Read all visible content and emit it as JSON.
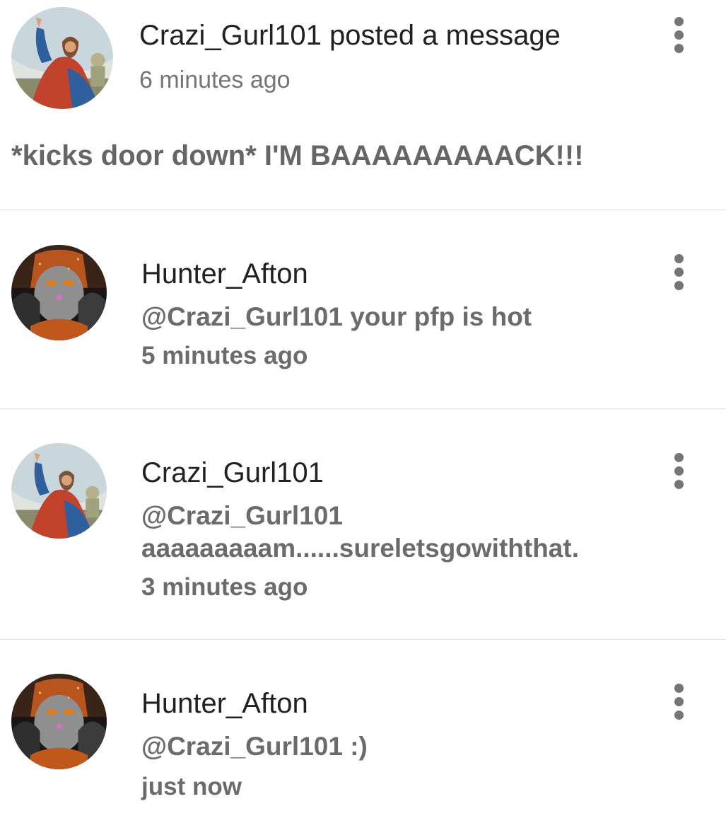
{
  "post": {
    "author": "Crazi_Gurl101",
    "title": "Crazi_Gurl101 posted a message",
    "time": "6 minutes ago",
    "body": "*kicks door down* I'M BAAAAAAAAACK!!!",
    "avatar": "jesus-painting-avatar"
  },
  "comments": [
    {
      "author": "Hunter_Afton",
      "text_line1": "@Crazi_Gurl101 your pfp is hot",
      "text_line2": "",
      "time": "5 minutes ago",
      "avatar": "dark-character-avatar"
    },
    {
      "author": "Crazi_Gurl101",
      "text_line1": "@Crazi_Gurl101",
      "text_line2": "aaaaaaaaam......sureletsgowiththat.",
      "time": "3 minutes ago",
      "avatar": "jesus-painting-avatar"
    },
    {
      "author": "Hunter_Afton",
      "text_line1": "@Crazi_Gurl101 :)",
      "text_line2": "",
      "time": "just now",
      "avatar": "dark-character-avatar"
    }
  ],
  "icons": {
    "more": "more-vertical-icon"
  },
  "colors": {
    "primary_text": "#212121",
    "secondary_text": "#757575",
    "divider": "#e0e0e0"
  }
}
